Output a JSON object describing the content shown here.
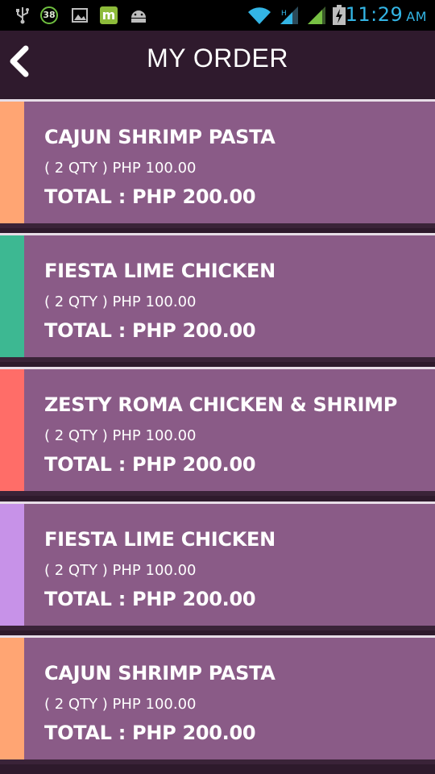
{
  "status_bar": {
    "notifications": [
      "usb-icon",
      "badge-icon",
      "image-icon",
      "market-icon",
      "android-icon"
    ],
    "badge_count": "38",
    "time": "11:29",
    "ampm": "AM",
    "time_color": "#33b5e5"
  },
  "header": {
    "title": "MY ORDER",
    "back_icon": "chevron-left-icon"
  },
  "colors": {
    "card_bg": "#8a5b87",
    "page_bg": "#2e1a2c"
  },
  "orders": [
    {
      "name": "CAJUN SHRIMP PASTA",
      "qty": "( 2 QTY ) PHP 100.00",
      "total": "TOTAL : PHP 200.00",
      "accent": "#ffa573"
    },
    {
      "name": "FIESTA LIME CHICKEN",
      "qty": "( 2 QTY ) PHP 100.00",
      "total": "TOTAL : PHP 200.00",
      "accent": "#3db892"
    },
    {
      "name": "ZESTY ROMA CHICKEN & SHRIMP",
      "qty": "( 2 QTY ) PHP 100.00",
      "total": "TOTAL : PHP 200.00",
      "accent": "#ff6d68"
    },
    {
      "name": "FIESTA LIME CHICKEN",
      "qty": "( 2 QTY ) PHP 100.00",
      "total": "TOTAL : PHP 200.00",
      "accent": "#c792e8"
    },
    {
      "name": "CAJUN SHRIMP PASTA",
      "qty": "( 2 QTY ) PHP 100.00",
      "total": "TOTAL : PHP 200.00",
      "accent": "#ffa573"
    }
  ]
}
